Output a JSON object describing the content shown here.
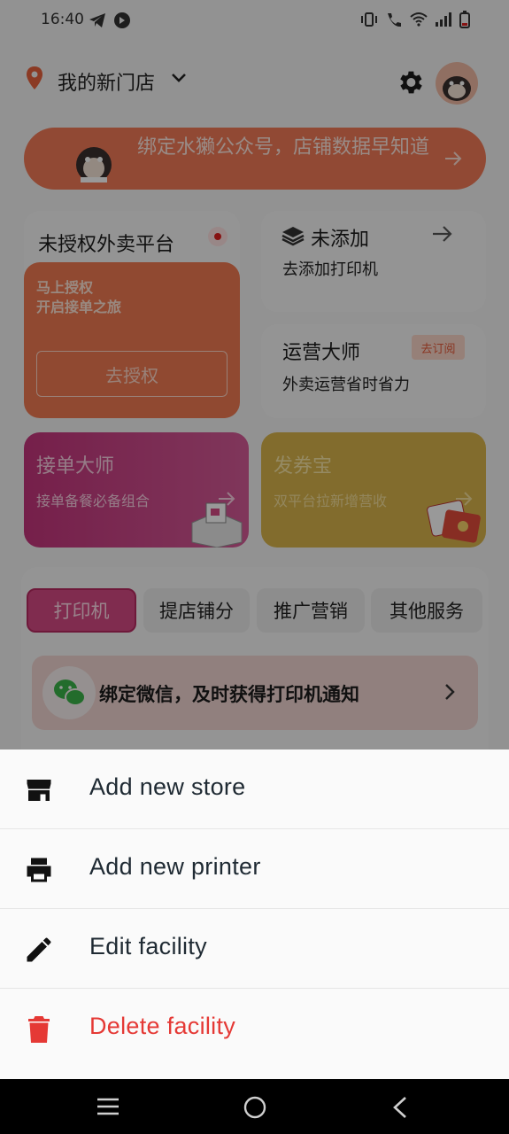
{
  "status": {
    "time": "16:40"
  },
  "header": {
    "store_name": "我的新门店"
  },
  "banner": {
    "text": "绑定水獭公众号，店铺数据早知道"
  },
  "auth_card": {
    "title": "未授权外卖平台",
    "subtitle_line1": "马上授权",
    "subtitle_line2": "开启接单之旅",
    "button": "去授权"
  },
  "printer_card": {
    "title": "未添加",
    "subtitle": "去添加打印机"
  },
  "ops_card": {
    "title": "运营大师",
    "badge": "去订阅",
    "subtitle": "外卖运营省时省力"
  },
  "order_card": {
    "title": "接单大师",
    "subtitle": "接单备餐必备组合"
  },
  "coupon_card": {
    "title": "发券宝",
    "subtitle": "双平台拉新增营收"
  },
  "tabs": [
    "打印机",
    "提店铺分",
    "推广营销",
    "其他服务"
  ],
  "wechat_row": {
    "text": "绑定微信，及时获得打印机通知"
  },
  "sheet": {
    "items": [
      {
        "label": "Add new store",
        "icon": "store-icon"
      },
      {
        "label": "Add new printer",
        "icon": "printer-icon"
      },
      {
        "label": "Edit facility",
        "icon": "pencil-icon"
      },
      {
        "label": "Delete facility",
        "icon": "trash-icon",
        "color": "#e53935"
      }
    ]
  },
  "colors": {
    "accent": "#f27a58",
    "danger": "#e53935",
    "pink": "#c4357c",
    "gold": "#d9b54c"
  }
}
